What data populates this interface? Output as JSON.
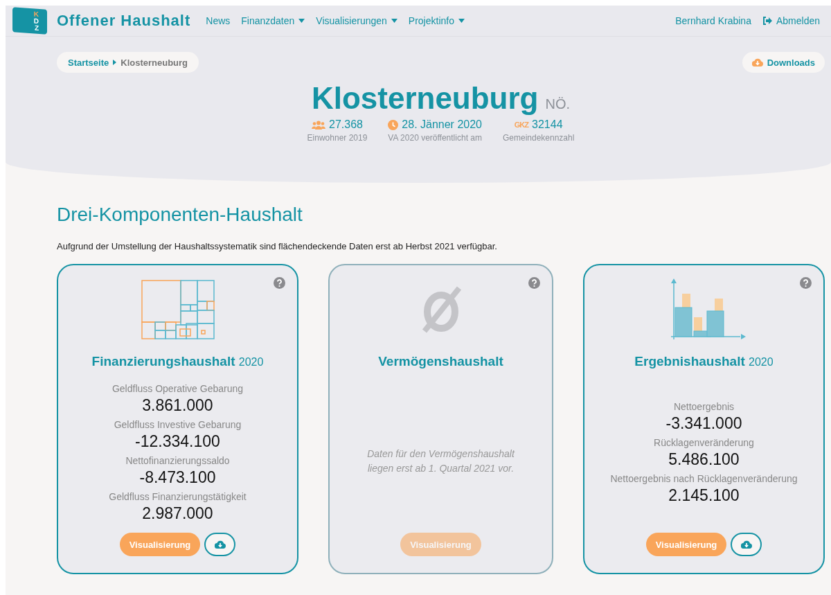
{
  "brand": {
    "logo_letters": [
      "K",
      "D",
      "Z"
    ],
    "title": "Offener Haushalt"
  },
  "nav": [
    {
      "label": "News",
      "dropdown": false
    },
    {
      "label": "Finanzdaten",
      "dropdown": true
    },
    {
      "label": "Visualisierungen",
      "dropdown": true
    },
    {
      "label": "Projektinfo",
      "dropdown": true
    }
  ],
  "user": {
    "name": "Bernhard Krabina",
    "logout": "Abmelden"
  },
  "breadcrumb": [
    {
      "label": "Startseite",
      "link": true
    },
    {
      "label": "Klosterneuburg",
      "link": false
    }
  ],
  "downloads_button": "Downloads",
  "municipality": {
    "name": "Klosterneuburg",
    "state": "NÖ."
  },
  "stats": [
    {
      "kind": "people",
      "value": "27.368",
      "caption": "Einwohner 2019"
    },
    {
      "kind": "clock",
      "value": "28. Jänner 2020",
      "caption": "VA 2020 veröffentlicht am"
    },
    {
      "kind": "gkz",
      "badge": "GKZ",
      "value": "32144",
      "caption": "Gemeindekennzahl"
    }
  ],
  "section": {
    "heading": "Drei-Komponenten-Haushalt",
    "note": "Aufgrund der Umstellung der Haushaltssystematik sind flächendeckende Daten erst ab Herbst 2021 verfügbar."
  },
  "cards": [
    {
      "kind": "figures",
      "title": "Finanzierungshaushalt",
      "year": "2020",
      "disabled": false,
      "metrics": [
        {
          "label": "Geldfluss Operative Gebarung",
          "value": "3.861.000"
        },
        {
          "label": "Geldfluss Investive Gebarung",
          "value": "-12.334.100"
        },
        {
          "label": "Nettofinanzierungssaldo",
          "value": "-8.473.100"
        },
        {
          "label": "Geldfluss Finanzierungstätigkeit",
          "value": "2.987.000"
        }
      ],
      "button": "Visualisierung",
      "download": true
    },
    {
      "kind": "placeholder",
      "title": "Vermögenshaushalt",
      "disabled": true,
      "message": "Daten für den Vermögenshaushalt liegen erst ab 1. Quartal 2021 vor.",
      "button": "Visualisierung",
      "download": false
    },
    {
      "kind": "figures",
      "title": "Ergebnishaushalt",
      "year": "2020",
      "disabled": false,
      "metrics": [
        {
          "label": "Nettoergebnis",
          "value": "-3.341.000"
        },
        {
          "label": "Rücklagenveränderung",
          "value": "5.486.100"
        },
        {
          "label": "Nettoergebnis nach Rücklagenveränderung",
          "value": "2.145.100"
        }
      ],
      "button": "Visualisierung",
      "download": true
    }
  ]
}
